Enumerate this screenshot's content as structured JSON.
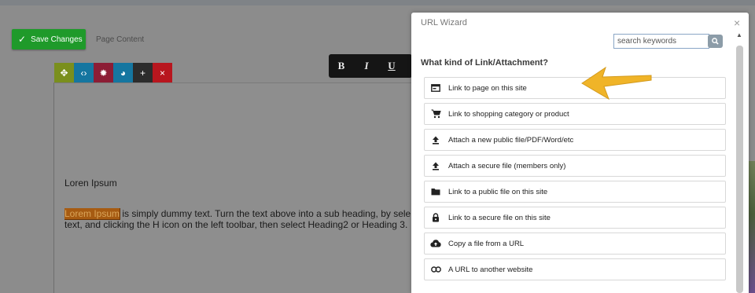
{
  "toolbar": {
    "save_label": "Save Changes",
    "page_content_label": "Page Content"
  },
  "format_bar": {
    "bold": "B",
    "italic": "I",
    "underline": "U"
  },
  "editor": {
    "heading_text": "Loren Ipsum",
    "highlight_text": "Lorem Ipsum",
    "body_line1": " is simply dummy text. Turn the text above into a sub heading, by sele",
    "body_line2": "text, and clicking the H icon on the left toolbar, then select Heading2 or Heading 3."
  },
  "modal": {
    "title": "URL Wizard",
    "close": "×",
    "search_placeholder": "search keywords",
    "question": "What kind of Link/Attachment?",
    "options": [
      {
        "label": "Link to page on this site",
        "icon": "page-icon"
      },
      {
        "label": "Link to shopping category or product",
        "icon": "cart-icon"
      },
      {
        "label": "Attach a new public file/PDF/Word/etc",
        "icon": "upload-icon"
      },
      {
        "label": "Attach a secure file (members only)",
        "icon": "upload-icon"
      },
      {
        "label": "Link to a public file on this site",
        "icon": "folder-icon"
      },
      {
        "label": "Link to a secure file on this site",
        "icon": "lock-icon"
      },
      {
        "label": "Copy a file from a URL",
        "icon": "cloud-upload-icon"
      },
      {
        "label": "A URL to another website",
        "icon": "link-icon"
      }
    ]
  },
  "colors": {
    "save": "#1f9a2a",
    "arrow": "#f0b428"
  }
}
